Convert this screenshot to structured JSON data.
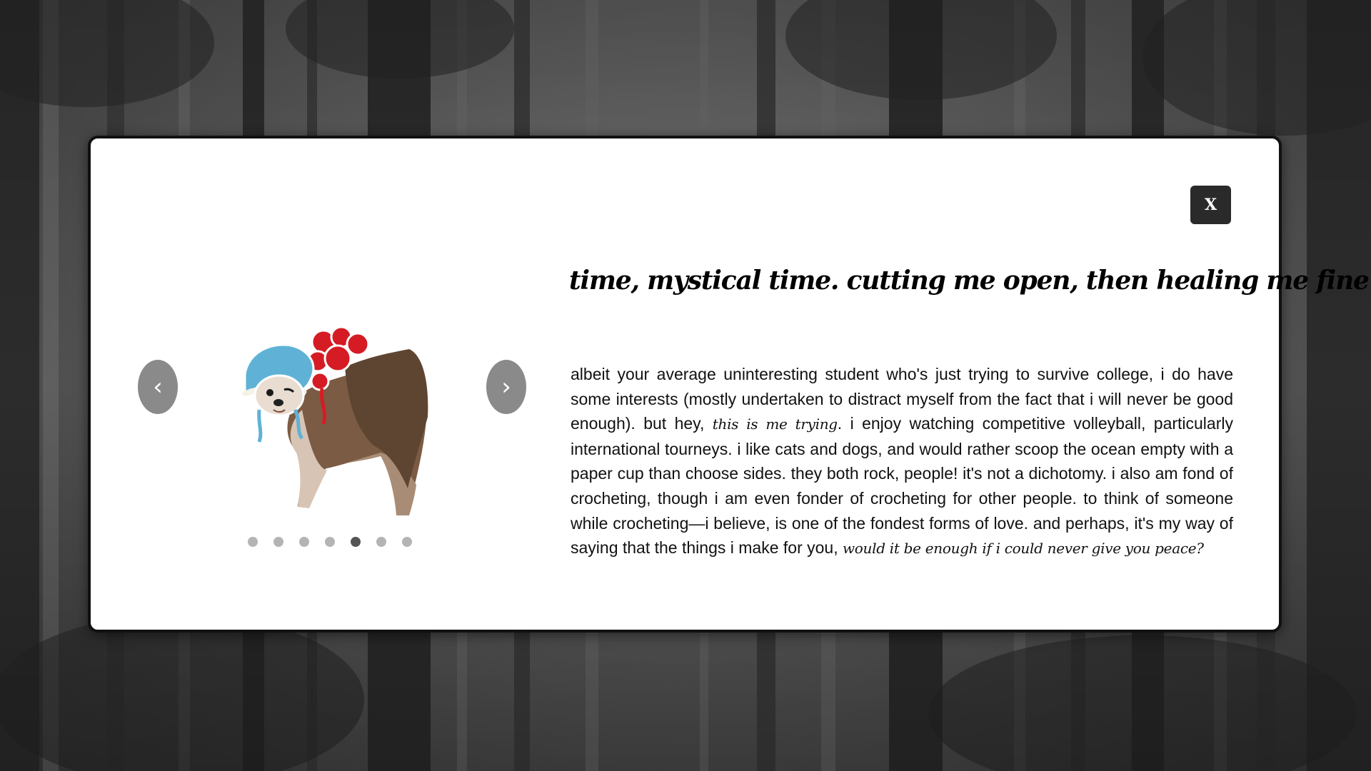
{
  "modal": {
    "close_label": "X",
    "headline": "time, mystical time. cutting me open, then healing me fine",
    "body": {
      "part1": "albeit your average uninteresting student who's just trying to survive college, i do have some interests (mostly undertaken to distract myself from the fact that i will never be good enough). but hey, ",
      "emphasis1": "this is me trying",
      "part2": ". i enjoy watching competitive volleyball, particularly international tourneys. i like cats and dogs, and would rather scoop the ocean empty with a paper cup than choose sides. they both rock, people! it's not a dichotomy. i also am fond of crocheting, though i am even fonder of crocheting for other people. to think of someone while crocheting—i believe, is one of the fondest forms of love. and perhaps, it's my way of saying that the things i make for you, ",
      "emphasis2": "would it be enough if i could never give you peace?"
    }
  },
  "carousel": {
    "prev_label": "‹",
    "next_label": "›",
    "image_alt": "chihuahua wearing crocheted bonnets",
    "slide_count": 7,
    "active_index": 4
  },
  "colors": {
    "modal_bg": "#ffffff",
    "close_bg": "#2a2a2a",
    "nav_bg": "#8a8a8a",
    "dot": "#b4b4b4",
    "dot_active": "#555555"
  },
  "icons": {
    "close": "close-icon",
    "prev": "chevron-left-icon",
    "next": "chevron-right-icon"
  }
}
